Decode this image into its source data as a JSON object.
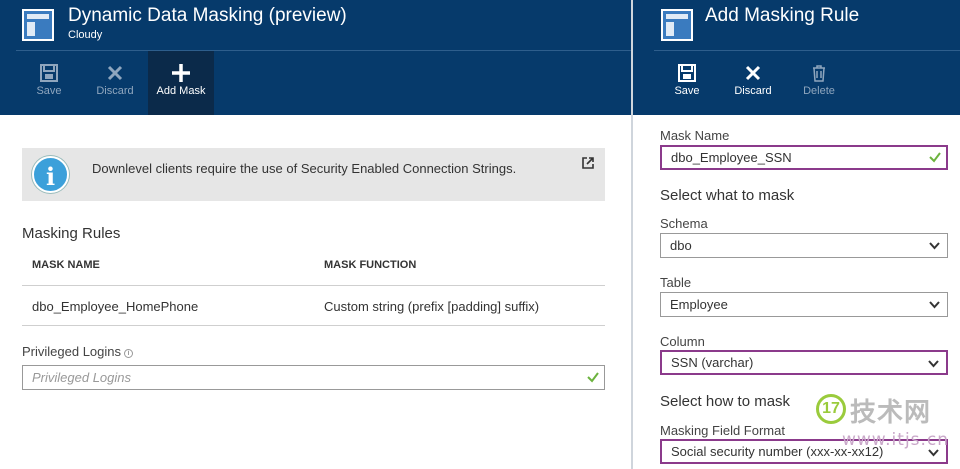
{
  "left_blade": {
    "title": "Dynamic Data Masking (preview)",
    "subtitle": "Cloudy",
    "toolbar": {
      "save_label": "Save",
      "discard_label": "Discard",
      "add_mask_label": "Add Mask"
    },
    "info_bar": {
      "text": "Downlevel clients require the use of Security Enabled Connection Strings."
    },
    "masking_rules": {
      "heading": "Masking Rules",
      "columns": [
        "MASK NAME",
        "MASK FUNCTION"
      ],
      "rows": [
        {
          "mask_name": "dbo_Employee_HomePhone",
          "mask_function": "Custom string (prefix [padding] suffix)"
        }
      ]
    },
    "privileged_logins": {
      "label": "Privileged Logins",
      "placeholder": "Privileged Logins"
    }
  },
  "right_blade": {
    "title": "Add Masking Rule",
    "toolbar": {
      "save_label": "Save",
      "discard_label": "Discard",
      "delete_label": "Delete"
    },
    "mask_name": {
      "label": "Mask Name",
      "value": "dbo_Employee_SSN"
    },
    "select_what_heading": "Select what to mask",
    "schema": {
      "label": "Schema",
      "value": "dbo"
    },
    "table": {
      "label": "Table",
      "value": "Employee"
    },
    "column": {
      "label": "Column",
      "value": "SSN (varchar)"
    },
    "select_how_heading": "Select how to mask",
    "masking_field_format": {
      "label": "Masking Field Format",
      "value": "Social security number (xxx-xx-xx12)"
    }
  },
  "watermark": {
    "name": "技术网",
    "badge": "17",
    "url": "www.itjs.cn"
  },
  "colors": {
    "header_bg": "#063a6b",
    "active_command_bg": "#0b2a4a",
    "valid_border": "#8b3a8b",
    "valid_check": "#6cb33e",
    "info_icon": "#3ca0da"
  }
}
